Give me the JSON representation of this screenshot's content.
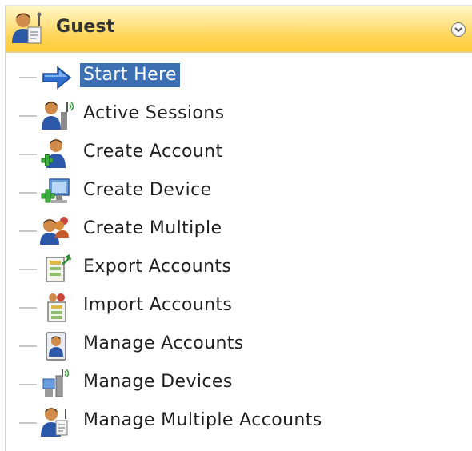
{
  "header": {
    "title": "Guest",
    "icon": "guest-user-icon",
    "collapse_icon": "chevron-down-icon"
  },
  "colors": {
    "header_gradient_top": "#fff6c6",
    "header_gradient_bottom": "#ffcc3a",
    "selection": "#3d6fb3"
  },
  "items": [
    {
      "label": "Start Here",
      "icon": "arrow-right-icon",
      "selected": true
    },
    {
      "label": "Active Sessions",
      "icon": "active-sessions-icon",
      "selected": false
    },
    {
      "label": "Create Account",
      "icon": "create-account-icon",
      "selected": false
    },
    {
      "label": "Create Device",
      "icon": "create-device-icon",
      "selected": false
    },
    {
      "label": "Create Multiple",
      "icon": "create-multiple-icon",
      "selected": false
    },
    {
      "label": "Export Accounts",
      "icon": "export-accounts-icon",
      "selected": false
    },
    {
      "label": "Import Accounts",
      "icon": "import-accounts-icon",
      "selected": false
    },
    {
      "label": "Manage Accounts",
      "icon": "manage-accounts-icon",
      "selected": false
    },
    {
      "label": "Manage Devices",
      "icon": "manage-devices-icon",
      "selected": false
    },
    {
      "label": "Manage Multiple Accounts",
      "icon": "manage-multiple-accounts-icon",
      "selected": false
    }
  ]
}
